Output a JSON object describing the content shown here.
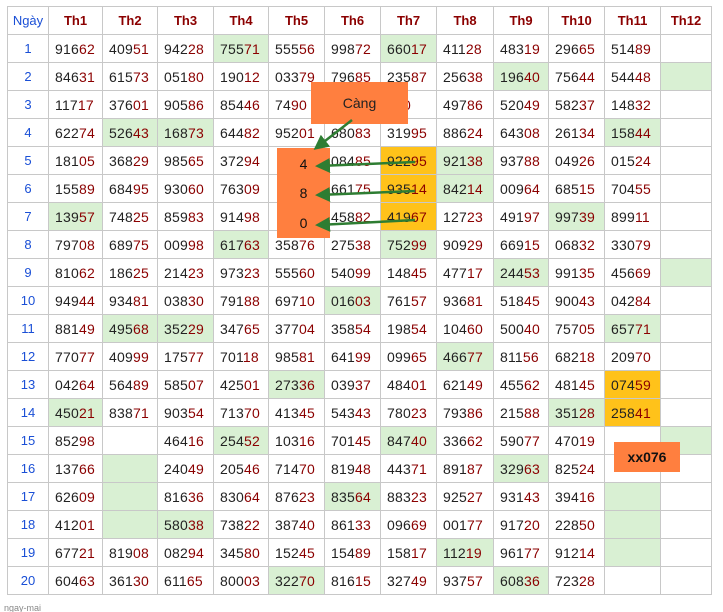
{
  "table": {
    "header": [
      "Ngày",
      "Th1",
      "Th2",
      "Th3",
      "Th4",
      "Th5",
      "Th6",
      "Th7",
      "Th8",
      "Th9",
      "Th10",
      "Th11",
      "Th12"
    ],
    "rows": [
      {
        "day": "1",
        "cells": [
          "91662",
          "40951",
          "94228",
          "75571",
          "55556",
          "99872",
          "66017",
          "41128",
          "48319",
          "29665",
          "51489",
          ""
        ]
      },
      {
        "day": "2",
        "cells": [
          "84631",
          "61573",
          "05180",
          "19012",
          "03379",
          "79685",
          "23587",
          "25638",
          "19640",
          "75644",
          "54448",
          ""
        ]
      },
      {
        "day": "3",
        "cells": [
          "11717",
          "37601",
          "90586",
          "85446",
          "7490",
          "",
          "530",
          "49786",
          "52049",
          "58237",
          "14832",
          ""
        ]
      },
      {
        "day": "4",
        "cells": [
          "62274",
          "52643",
          "16873",
          "64482",
          "95201",
          "68083",
          "31995",
          "88624",
          "64308",
          "26134",
          "15844",
          ""
        ]
      },
      {
        "day": "5",
        "cells": [
          "18105",
          "36829",
          "98565",
          "37294",
          "",
          "08485",
          "92295",
          "92138",
          "93788",
          "04926",
          "01524",
          ""
        ]
      },
      {
        "day": "6",
        "cells": [
          "15589",
          "68495",
          "93060",
          "76309",
          "",
          "66175",
          "93514",
          "84214",
          "00964",
          "68515",
          "70455",
          ""
        ]
      },
      {
        "day": "7",
        "cells": [
          "13957",
          "74825",
          "85983",
          "91498",
          "",
          "45882",
          "41967",
          "12723",
          "49197",
          "99739",
          "89911",
          ""
        ]
      },
      {
        "day": "8",
        "cells": [
          "79708",
          "68975",
          "00998",
          "61763",
          "35876",
          "27538",
          "75299",
          "90929",
          "66915",
          "06832",
          "33079",
          ""
        ]
      },
      {
        "day": "9",
        "cells": [
          "81062",
          "18625",
          "21423",
          "97323",
          "55560",
          "54099",
          "14845",
          "47717",
          "24453",
          "99135",
          "45669",
          ""
        ]
      },
      {
        "day": "10",
        "cells": [
          "94944",
          "93481",
          "03830",
          "79188",
          "69710",
          "01603",
          "76157",
          "93681",
          "51845",
          "90043",
          "04284",
          ""
        ]
      },
      {
        "day": "11",
        "cells": [
          "88149",
          "49568",
          "35229",
          "34765",
          "37704",
          "35854",
          "19854",
          "10460",
          "50040",
          "75705",
          "65771",
          ""
        ]
      },
      {
        "day": "12",
        "cells": [
          "77077",
          "40999",
          "17577",
          "70118",
          "98581",
          "64199",
          "09965",
          "46677",
          "81156",
          "68218",
          "20970",
          ""
        ]
      },
      {
        "day": "13",
        "cells": [
          "04264",
          "56489",
          "58507",
          "42501",
          "27336",
          "03937",
          "48401",
          "62149",
          "45562",
          "48145",
          "07459",
          ""
        ]
      },
      {
        "day": "14",
        "cells": [
          "45021",
          "83871",
          "90354",
          "71370",
          "41345",
          "54343",
          "78023",
          "79386",
          "21588",
          "35128",
          "25841",
          ""
        ]
      },
      {
        "day": "15",
        "cells": [
          "85298",
          "",
          "46416",
          "25452",
          "10316",
          "70145",
          "84740",
          "33662",
          "59077",
          "47019",
          "",
          ""
        ]
      },
      {
        "day": "16",
        "cells": [
          "13766",
          "",
          "24049",
          "20546",
          "71470",
          "81948",
          "44371",
          "89187",
          "32963",
          "82524",
          "",
          ""
        ]
      },
      {
        "day": "17",
        "cells": [
          "62609",
          "",
          "81636",
          "83064",
          "87623",
          "83564",
          "88323",
          "92527",
          "93143",
          "39416",
          "",
          ""
        ]
      },
      {
        "day": "18",
        "cells": [
          "41201",
          "",
          "58038",
          "73822",
          "38740",
          "86133",
          "09669",
          "00177",
          "91720",
          "22850",
          "",
          ""
        ]
      },
      {
        "day": "19",
        "cells": [
          "67721",
          "81908",
          "08294",
          "34580",
          "15245",
          "15489",
          "15817",
          "11219",
          "96177",
          "91214",
          "",
          ""
        ]
      },
      {
        "day": "20",
        "cells": [
          "60463",
          "36130",
          "61165",
          "80003",
          "32270",
          "81615",
          "32749",
          "93757",
          "60836",
          "72328",
          "",
          ""
        ]
      }
    ],
    "green_cells": [
      "1-3",
      "1-6",
      "2-8",
      "2-11",
      "4-1",
      "4-2",
      "4-10",
      "5-7",
      "6-7",
      "7-0",
      "7-9",
      "8-3",
      "8-6",
      "9-8",
      "9-11",
      "10-5",
      "11-1",
      "11-2",
      "11-10",
      "12-7",
      "13-4",
      "14-0",
      "14-9",
      "15-3",
      "15-6",
      "15-11",
      "16-1",
      "16-8",
      "17-1",
      "17-5",
      "17-10",
      "18-1",
      "18-2",
      "18-10",
      "19-7",
      "19-10",
      "20-4",
      "20-8"
    ],
    "orange_cells": [
      "5-6",
      "6-6",
      "7-6",
      "13-10",
      "14-10"
    ]
  },
  "overlays": {
    "cang_label": "Càng",
    "digits": [
      "4",
      "8",
      "0"
    ],
    "xx_label": "xx076",
    "footer": "ngay-mai"
  },
  "colors": {
    "accent_orange": "#ff7f3f",
    "highlight_green": "#d9f0d3",
    "highlight_yellow": "#ffc21a",
    "number_tail": "#8b0000",
    "day_blue": "#1a4fd6",
    "arrow_green": "#2e7d32"
  }
}
